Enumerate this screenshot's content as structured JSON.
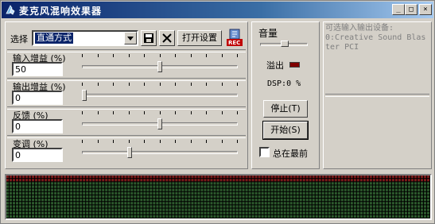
{
  "window": {
    "title": "麦克风混响效果器"
  },
  "titlebar_buttons": {
    "minimize": "_",
    "maximize": "□",
    "close": "×"
  },
  "toolbar": {
    "select_label": "选择",
    "preset_value": "直通方式",
    "open_settings_label": "打开设置",
    "rec_label": "REC"
  },
  "sliders": [
    {
      "label": "输入增益 (%)",
      "value": "50",
      "level": 0.5
    },
    {
      "label": "输出增益 (%)",
      "value": "0",
      "level": 0.0
    },
    {
      "label": "反馈 (%)",
      "value": "0",
      "level": 0.5
    },
    {
      "label": "变调 (%)",
      "value": "0",
      "level": 0.3
    }
  ],
  "middle": {
    "volume_label": "音量",
    "overflow_label": "溢出",
    "dsp_text": "DSP:0 %",
    "stop_label": "停止(T)",
    "start_label": "开始(S)",
    "always_on_top_label": "总在最前",
    "overflow_color": "#800000"
  },
  "devices": {
    "header": "可选输入输出设备:",
    "items": [
      "0:Creative Sound Blaster PCI"
    ]
  },
  "colors": {
    "title_start": "#0a246a",
    "title_end": "#a6caf0",
    "viz_green": "#2d5a2d",
    "viz_red": "#7a1a1a"
  }
}
